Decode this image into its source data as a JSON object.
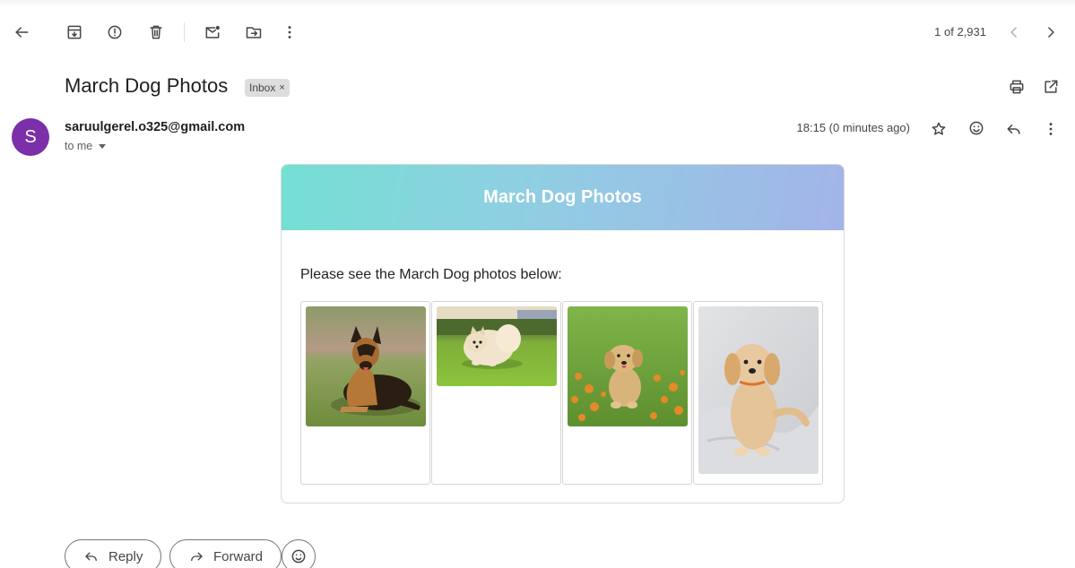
{
  "toolbar": {
    "back": "arrow-left-icon",
    "archive": "archive-icon",
    "spam": "report-spam-icon",
    "delete": "trash-icon",
    "unread": "mark-unread-icon",
    "move": "move-to-folder-icon",
    "more": "more-vert-icon",
    "counter": "1 of 2,931",
    "prev": "chevron-left-icon",
    "next": "chevron-right-icon"
  },
  "email": {
    "subject": "March Dog Photos",
    "label": "Inbox",
    "label_remove": "×",
    "avatar_letter": "S",
    "sender": "saruulgerel.o325@gmail.com",
    "recipient": "to me",
    "timestamp": "18:15 (0 minutes ago)"
  },
  "message": {
    "banner_title": "March Dog Photos",
    "body_text": "Please see the March Dog photos below:",
    "photos": [
      {
        "subject": "German Shepherd lying on grass"
      },
      {
        "subject": "Pomeranian running on lawn"
      },
      {
        "subject": "Golden retriever puppy among orange flowers"
      },
      {
        "subject": "Fluffy puppy sitting on white blanket"
      }
    ]
  },
  "actions": {
    "reply": "Reply",
    "forward": "Forward"
  },
  "colors": {
    "avatar": "#7b2fa9",
    "banner_start": "#74e0d2",
    "banner_end": "#a3b4e8"
  }
}
